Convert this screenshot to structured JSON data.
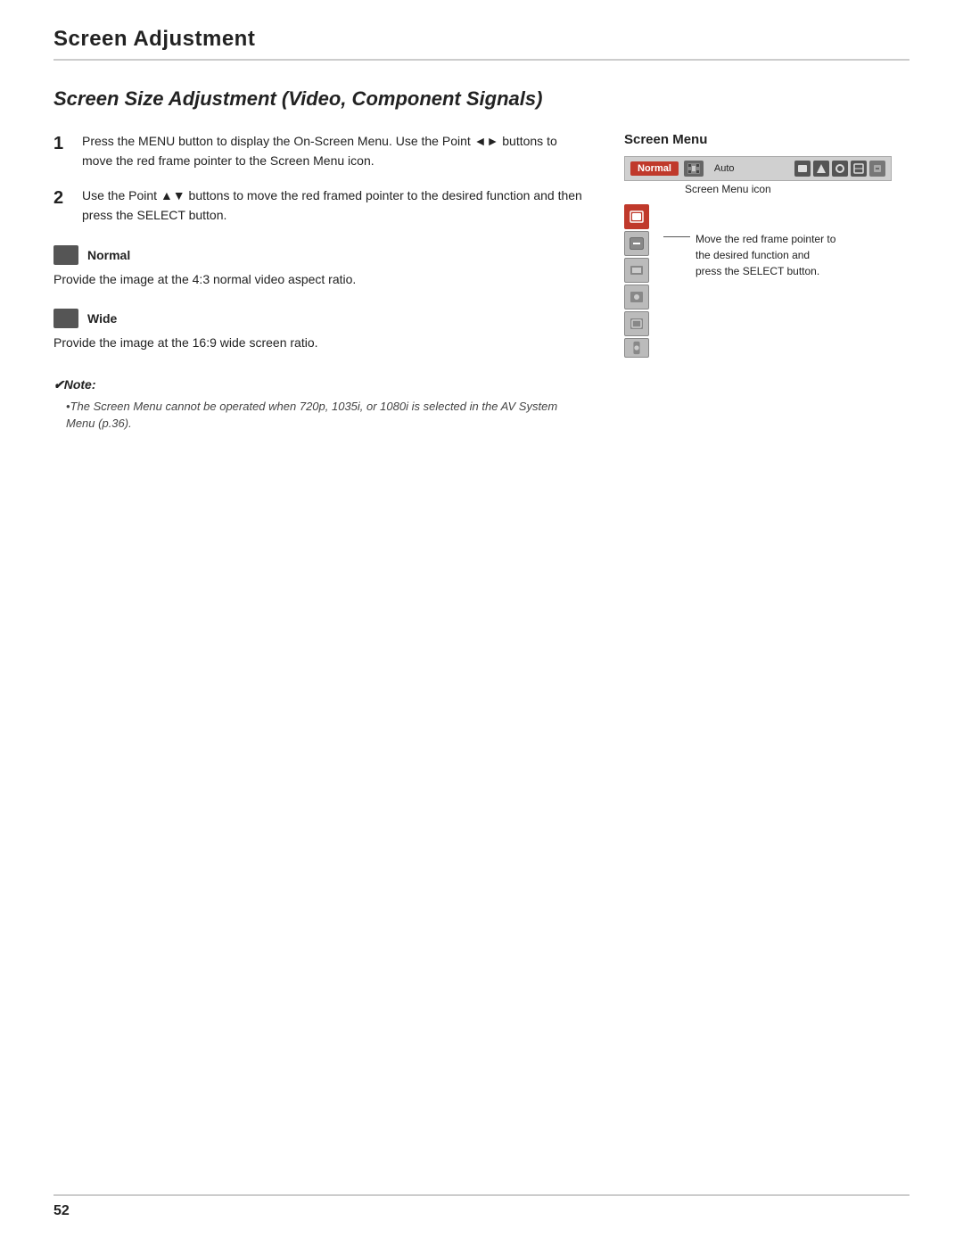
{
  "header": {
    "title": "Screen Adjustment"
  },
  "section": {
    "title": "Screen Size Adjustment (Video, Component Signals)"
  },
  "steps": [
    {
      "number": "1",
      "text": "Press the MENU button to display the On-Screen Menu. Use the Point ◄► buttons to move the red frame pointer to the Screen Menu icon."
    },
    {
      "number": "2",
      "text": "Use the Point ▲▼ buttons to move the red framed pointer to the desired function and then press the SELECT button."
    }
  ],
  "items": [
    {
      "label": "Normal",
      "desc": "Provide the image at the 4:3 normal video aspect ratio."
    },
    {
      "label": "Wide",
      "desc": "Provide the image at the 16:9 wide screen ratio."
    }
  ],
  "note": {
    "title": "✔Note:",
    "bullet": "•The Screen Menu cannot be operated when 720p, 1035i, or 1080i is selected in the AV System Menu (p.36)."
  },
  "screen_menu": {
    "label": "Screen Menu",
    "bar_normal": "Normal",
    "bar_auto": "Auto",
    "annotation1": "Screen Menu icon",
    "annotation2": "Move the red frame pointer to the desired function and press the SELECT button."
  },
  "footer": {
    "page_number": "52"
  }
}
